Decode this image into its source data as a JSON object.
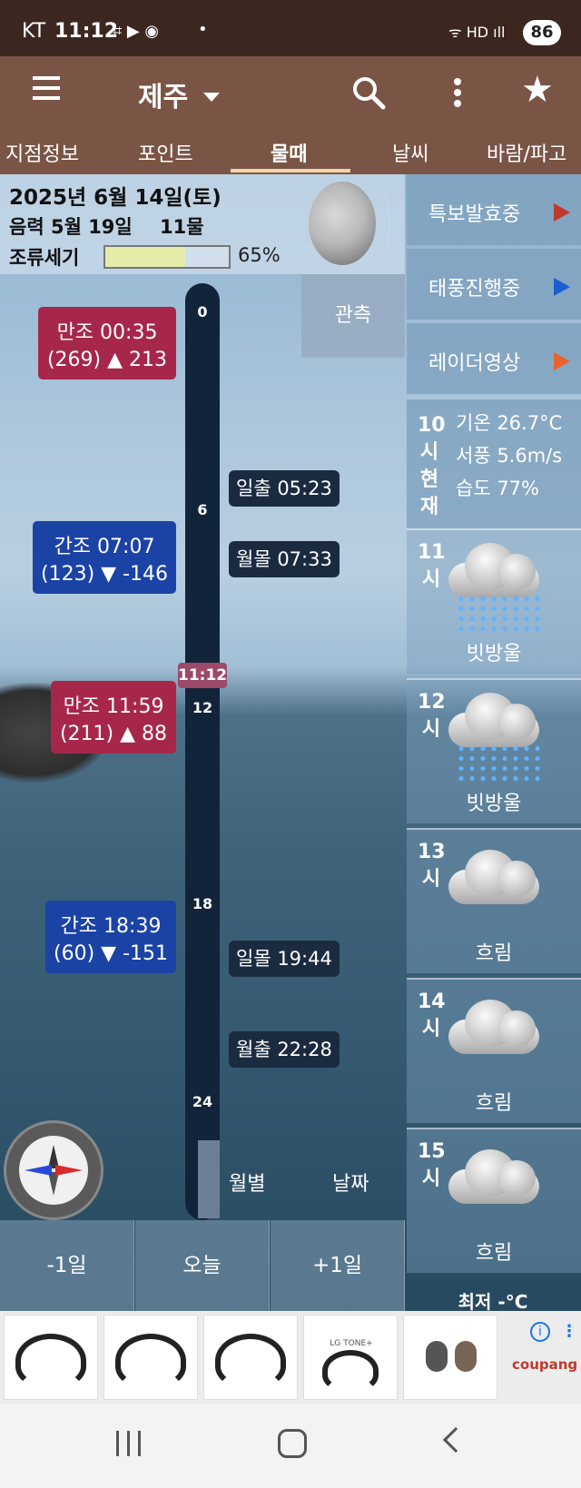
{
  "status": {
    "carrier": "KT",
    "time": "11:12",
    "icons_left": "⌗ ▶ ◉",
    "dot": "•",
    "icons_right": "ᯤ HD ıll",
    "battery": "86"
  },
  "appbar": {
    "location": "제주"
  },
  "tabs": [
    "지점정보",
    "포인트",
    "물때",
    "날씨",
    "바람/파고"
  ],
  "active_tab": "물때",
  "info": {
    "date": "2025년 6월 14일(토)",
    "lunar": "음력 5월 19일",
    "moon_age": "11물",
    "strength_label": "조류세기",
    "strength_percent": 65,
    "strength_text": "65%"
  },
  "observation": "관측",
  "side_buttons": [
    {
      "label": "특보발효중",
      "arrow_color": "#c0392b"
    },
    {
      "label": "태풍진행중",
      "arrow_color": "#1a5fd1"
    },
    {
      "label": "레이더영상",
      "arrow_color": "#e8632b"
    }
  ],
  "current": {
    "hour_label": "10시현재",
    "temp": "기온 26.7°C",
    "wind": "서풍 5.6m/s",
    "humidity": "습도 77%"
  },
  "forecast": [
    {
      "hour": "11시",
      "condition": "빗방울",
      "icon": "rain-cloud-icon"
    },
    {
      "hour": "12시",
      "condition": "빗방울",
      "icon": "rain-cloud-icon"
    },
    {
      "hour": "13시",
      "condition": "흐림",
      "icon": "cloud-icon"
    },
    {
      "hour": "14시",
      "condition": "흐림",
      "icon": "cloud-icon"
    },
    {
      "hour": "15시",
      "condition": "흐림",
      "icon": "cloud-icon"
    }
  ],
  "forecast_cutoff": "최저 -°C",
  "timeline": {
    "ticks": [
      "0",
      "6",
      "12",
      "18",
      "24"
    ],
    "now": "11:12"
  },
  "tides": [
    {
      "type": "만조",
      "time": "00:35",
      "line1": "만조 00:35",
      "line2": "(269) ▲ 213"
    },
    {
      "type": "간조",
      "time": "07:07",
      "line1": "간조 07:07",
      "line2": "(123) ▼ -146"
    },
    {
      "type": "만조",
      "time": "11:59",
      "line1": "만조 11:59",
      "line2": "(211) ▲ 88"
    },
    {
      "type": "간조",
      "time": "18:39",
      "line1": "간조 18:39",
      "line2": "(60) ▼ -151"
    }
  ],
  "events": [
    {
      "label": "일출 05:23"
    },
    {
      "label": "월몰 07:33"
    },
    {
      "label": "일몰 19:44"
    },
    {
      "label": "월출 22:28"
    }
  ],
  "calendar_buttons": {
    "monthly": "월별",
    "date": "날짜"
  },
  "day_nav": {
    "prev": "-1일",
    "today": "오늘",
    "next": "+1일"
  },
  "ad": {
    "info": "i",
    "kebab": "⋮",
    "brand": "coupang",
    "item4_text": "LG TONE+"
  }
}
